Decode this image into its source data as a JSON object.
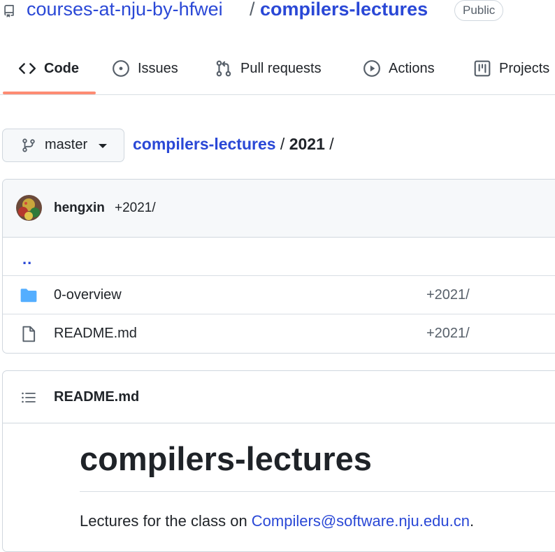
{
  "repo": {
    "owner": "courses-at-nju-by-hfwei",
    "separator": "/",
    "name": "compilers-lectures",
    "visibility": "Public"
  },
  "tabs": [
    {
      "label": "Code",
      "icon": "code-icon",
      "selected": true
    },
    {
      "label": "Issues",
      "icon": "issue-circle-icon",
      "selected": false
    },
    {
      "label": "Pull requests",
      "icon": "pull-request-icon",
      "selected": false
    },
    {
      "label": "Actions",
      "icon": "play-circle-icon",
      "selected": false
    },
    {
      "label": "Projects",
      "icon": "project-board-icon",
      "selected": false
    }
  ],
  "branch": {
    "label": "master"
  },
  "breadcrumb": {
    "root": "compilers-lectures",
    "sep": " / ",
    "current": "2021",
    "trail": " /"
  },
  "commit": {
    "author": "hengxin",
    "message": "+2021/"
  },
  "files": {
    "parent": "..",
    "items": [
      {
        "name": "0-overview",
        "type": "folder",
        "commit_message": "+2021/"
      },
      {
        "name": "README.md",
        "type": "file",
        "commit_message": "+2021/"
      }
    ]
  },
  "readme": {
    "filename": "README.md",
    "heading": "compilers-lectures",
    "paragraph_prefix": "Lectures for the class on ",
    "link_text": "Compilers@software.nju.edu.cn",
    "paragraph_suffix": "."
  },
  "colors": {
    "link": "#2a48d6",
    "tab_underline": "#fd8c73",
    "folder": "#54aeff"
  }
}
